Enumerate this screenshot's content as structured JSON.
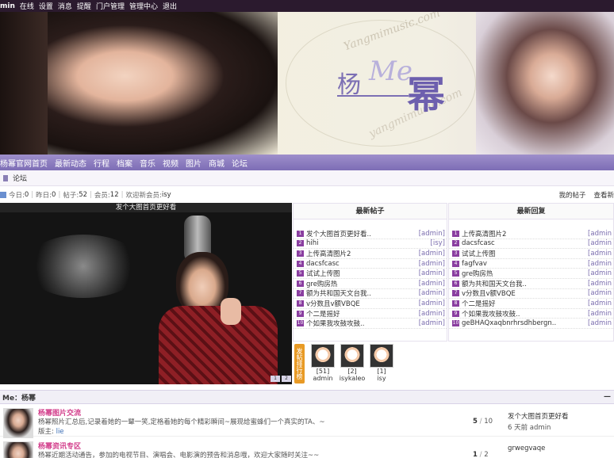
{
  "topbar": {
    "items": [
      "min",
      "在线",
      "设置",
      "消息",
      "提醒",
      "门户管理",
      "管理中心",
      "退出"
    ]
  },
  "banner": {
    "logo_yang": "杨",
    "logo_me": "Me",
    "logo_mi": "幂",
    "watermark": "Yangmimusic.com",
    "watermark2": "yangmimusic.com"
  },
  "nav": {
    "items": [
      "杨幂官网首页",
      "最新动态",
      "行程",
      "档案",
      "音乐",
      "视频",
      "图片",
      "商城",
      "论坛"
    ]
  },
  "breadcrumb": {
    "current": "论坛"
  },
  "stats": {
    "today_label": "今日:",
    "today": "0",
    "yesterday_label": "昨日:",
    "yesterday": "0",
    "posts_label": "帖子:",
    "posts": "52",
    "members_label": "会员:",
    "members": "12",
    "welcome_label": "欢迎新会员:",
    "newest": "isy",
    "my_posts": "我的帖子",
    "view_new": "查看新"
  },
  "feature": {
    "title": "发个大图首页更好看"
  },
  "latest_posts": {
    "title": "最新帖子",
    "items": [
      {
        "n": "1",
        "title": "发个大图首页更好看..",
        "author": "[admin]"
      },
      {
        "n": "2",
        "title": "hihi",
        "author": "[isy]"
      },
      {
        "n": "3",
        "title": "上传高清图片2",
        "author": "[admin]"
      },
      {
        "n": "4",
        "title": "dacsfcasc",
        "author": "[admin]"
      },
      {
        "n": "5",
        "title": "试试上传图",
        "author": "[admin]"
      },
      {
        "n": "6",
        "title": "gre购房热",
        "author": "[admin]"
      },
      {
        "n": "7",
        "title": "额为共和国天文台我..",
        "author": "[admin]"
      },
      {
        "n": "8",
        "title": "v分数且v额VBQE",
        "author": "[admin]"
      },
      {
        "n": "9",
        "title": "个二是摇好",
        "author": "[admin]"
      },
      {
        "n": "10",
        "title": "个如果我攻鼓攻鼓..",
        "author": "[admin]"
      }
    ]
  },
  "latest_replies": {
    "title": "最新回复",
    "items": [
      {
        "n": "1",
        "title": "上传高清图片2",
        "author": "[admin"
      },
      {
        "n": "2",
        "title": "dacsfcasc",
        "author": "[admin"
      },
      {
        "n": "3",
        "title": "试试上传图",
        "author": "[admin"
      },
      {
        "n": "4",
        "title": "fagfvav",
        "author": "[admin"
      },
      {
        "n": "5",
        "title": "gre购房热",
        "author": "[admin"
      },
      {
        "n": "6",
        "title": "额为共和国天文台我..",
        "author": "[admin"
      },
      {
        "n": "7",
        "title": "v分数且v额VBQE",
        "author": "[admin"
      },
      {
        "n": "8",
        "title": "个二是摇好",
        "author": "[admin"
      },
      {
        "n": "9",
        "title": "个如果我攻鼓攻鼓..",
        "author": "[admin"
      },
      {
        "n": "10",
        "title": "geBHAQxaqbnrhrsdhbergn..",
        "author": "[admin"
      }
    ]
  },
  "ranking": {
    "tag": "发帖排行榜",
    "users": [
      {
        "count": "[51]",
        "name": "admin"
      },
      {
        "count": "[2]",
        "name": "isykaleo"
      },
      {
        "count": "[1]",
        "name": "isy"
      }
    ]
  },
  "section": {
    "title": "Me：杨幂",
    "collapse": "—"
  },
  "forums": [
    {
      "name": "杨幂图片交流",
      "desc": "杨幂照片汇总后,记录着她的一颦一笑,定格着她的每个精彩瞬间~展现给蜜蜂们一个真实的TA、~",
      "mod_label": "版主:",
      "mod": "lie",
      "threads": "5",
      "posts": "10",
      "last_title": "发个大图首页更好看",
      "last_meta": "6 天前 admin"
    },
    {
      "name": "杨幂资讯专区",
      "desc": "杨幂近期活动通告，参加的电视节目、演唱会、电影演的预告和消息哦，欢迎大家随时关注~~",
      "mod_label": "",
      "mod": "",
      "threads": "1",
      "posts": "2",
      "last_title": "grwegvaqe",
      "last_meta": ""
    }
  ]
}
